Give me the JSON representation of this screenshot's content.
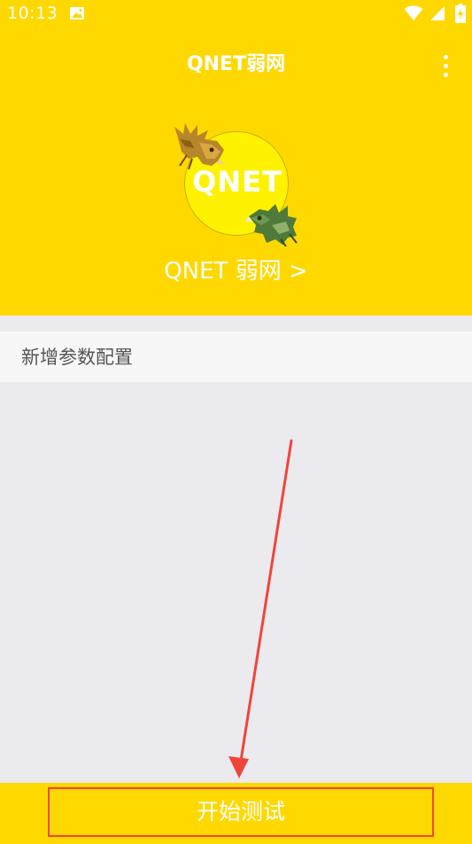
{
  "status_bar": {
    "time": "10:13",
    "icons": [
      "gallery-icon",
      "wifi-icon",
      "signal-icon",
      "battery-charging-icon"
    ]
  },
  "header": {
    "title": "QNET弱网",
    "menu_icon": "more-vertical-icon",
    "logo_text": "QNET",
    "subtitle_link": "QNET 弱网 >"
  },
  "content": {
    "add_config_label": "新增参数配置"
  },
  "footer": {
    "start_button_label": "开始测试"
  },
  "colors": {
    "brand_yellow": "#ffd800",
    "content_background": "#eaeaef",
    "row_background": "#f7f7f7",
    "annotation_red": "#f0453a"
  }
}
